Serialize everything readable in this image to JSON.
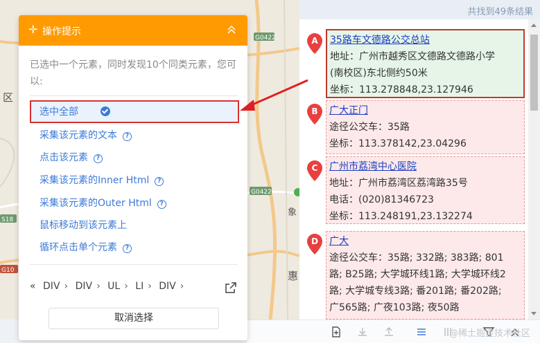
{
  "results_header": {
    "count_text": "共找到49条结果"
  },
  "map": {
    "district_label": "区",
    "road_labels": [
      "G0422",
      "G0422",
      "S18",
      "G10"
    ],
    "place_label": "象",
    "place_label_2": "惠"
  },
  "results": [
    {
      "marker": "A",
      "title": "35路车文德路公交总站",
      "lines": [
        "地址：广州市越秀区文德路文德路小学",
        "(南校区)东北侧约50米",
        "坐标：113.278848,23.127946"
      ]
    },
    {
      "marker": "B",
      "title": "广大正门",
      "lines": [
        "途径公交车：35路",
        "坐标：113.378142,23.04296"
      ]
    },
    {
      "marker": "C",
      "title": "广州市荔湾中心医院",
      "lines": [
        "地址：广州市荔湾区荔湾路35号",
        "电话：(020)81346723",
        "坐标：113.248191,23.132274"
      ]
    },
    {
      "marker": "D",
      "title": "广大",
      "lines": [
        "途径公交车：35路; 332路; 383路; 801",
        "路; B25路; 大学城环线1路; 大学城环线2",
        "路; 大学城专线3路; 番201路; 番202路;",
        "广565路; 广夜103路; 夜50路"
      ]
    }
  ],
  "tip": {
    "title": "操作提示",
    "description": "已选中一个元素，同时发现10个同类元素，您可以:",
    "options": [
      "选中全部",
      "采集该元素的文本",
      "点击该元素",
      "采集该元素的Inner Html",
      "采集该元素的Outer Html",
      "鼠标移动到该元素上",
      "循环点击单个元素"
    ],
    "help_glyph": "?",
    "path": [
      "DIV",
      "DIV",
      "UL",
      "LI",
      "DIV"
    ],
    "cancel_label": "取消选择"
  },
  "watermark": "@稀土掘金技术社区",
  "colors": {
    "accent": "#ff9a00",
    "link": "#3b7ad8",
    "highlight": "#d93030"
  },
  "icons": [
    "plus-icon",
    "collapse-chevron-up-icon",
    "check-circle-icon",
    "help-icon",
    "double-chevron-left-icon",
    "open-external-icon",
    "marker-pin-icon",
    "add-page-icon",
    "download-icon",
    "upload-icon",
    "list-icon",
    "columns-icon",
    "filter-icon",
    "chevron-up-icon"
  ]
}
